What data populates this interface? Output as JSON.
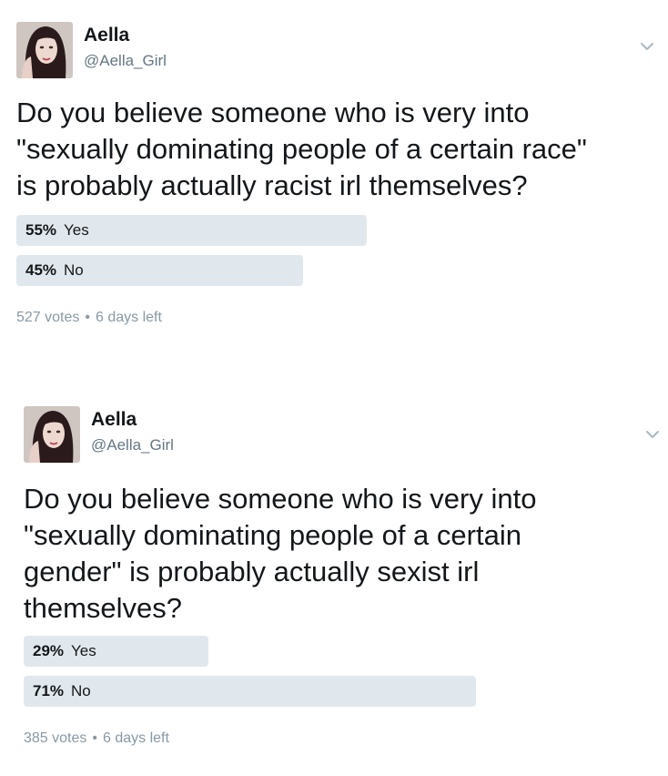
{
  "tweets": [
    {
      "author": {
        "name": "Aella",
        "handle": "@Aella_Girl"
      },
      "question": "Do you believe someone who is very into\n\"sexually dominating people of a certain race\"\nis probably actually racist irl themselves?",
      "options": [
        {
          "percent_label": "55%",
          "label": "Yes",
          "value": 55
        },
        {
          "percent_label": "45%",
          "label": "No",
          "value": 45
        }
      ],
      "votes": "527 votes",
      "separator": "•",
      "time_left": "6 days left"
    },
    {
      "author": {
        "name": "Aella",
        "handle": "@Aella_Girl"
      },
      "question": "Do you believe someone who is very into\n\"sexually dominating people of a certain\ngender\" is probably actually sexist irl\nthemselves?",
      "options": [
        {
          "percent_label": "29%",
          "label": "Yes",
          "value": 29
        },
        {
          "percent_label": "71%",
          "label": "No",
          "value": 71
        }
      ],
      "votes": "385 votes",
      "separator": "•",
      "time_left": "6 days left"
    }
  ],
  "icons": {
    "menu": "chevron-down-icon",
    "avatar": "avatar"
  },
  "colors": {
    "bar": "#e1e8ed",
    "text": "#14171a",
    "muted": "#8899a6",
    "handle": "#657786"
  }
}
